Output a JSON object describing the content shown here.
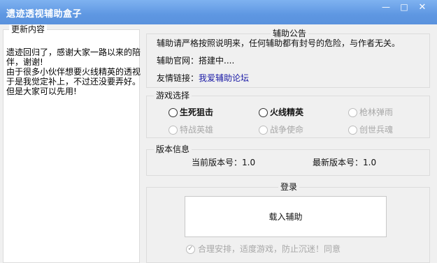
{
  "window": {
    "title": "遗迹透视辅助盒子",
    "controls": {
      "minimize": "—",
      "maximize": "□",
      "close": "✕"
    }
  },
  "update": {
    "title": "更新内容",
    "lines": [
      "遗迹回归了，感谢大家一路以来的陪",
      "伴，谢谢!",
      "由于很多小伙伴想要火线精英的透视",
      "于是我觉定补上，不过还没要弄好。",
      "但是大家可以先用!"
    ]
  },
  "notice": {
    "title": "辅助公告",
    "warning": "辅助请严格按照说明来，任何辅助都有封号的危险，与作者无关。",
    "website_label": "辅助官网：",
    "website_value": "搭建中....",
    "links_label": "友情链接：",
    "links_value": "我爱辅助论坛"
  },
  "games": {
    "title": "游戏选择",
    "options": [
      {
        "label": "生死狙击",
        "enabled": true
      },
      {
        "label": "火线精英",
        "enabled": true
      },
      {
        "label": "枪林弹雨",
        "enabled": false
      },
      {
        "label": "特战英雄",
        "enabled": false
      },
      {
        "label": "战争使命",
        "enabled": false
      },
      {
        "label": "创世兵魂",
        "enabled": false
      }
    ]
  },
  "version": {
    "title": "版本信息",
    "current_label": "当前版本号：",
    "current_value": "1.0",
    "latest_label": "最新版本号：",
    "latest_value": "1.0"
  },
  "login": {
    "title": "登录",
    "load_button": "载入辅助",
    "agree_text": "合理安排，适度游戏，防止沉迷！同意"
  },
  "icons": {
    "check": "check-icon"
  }
}
